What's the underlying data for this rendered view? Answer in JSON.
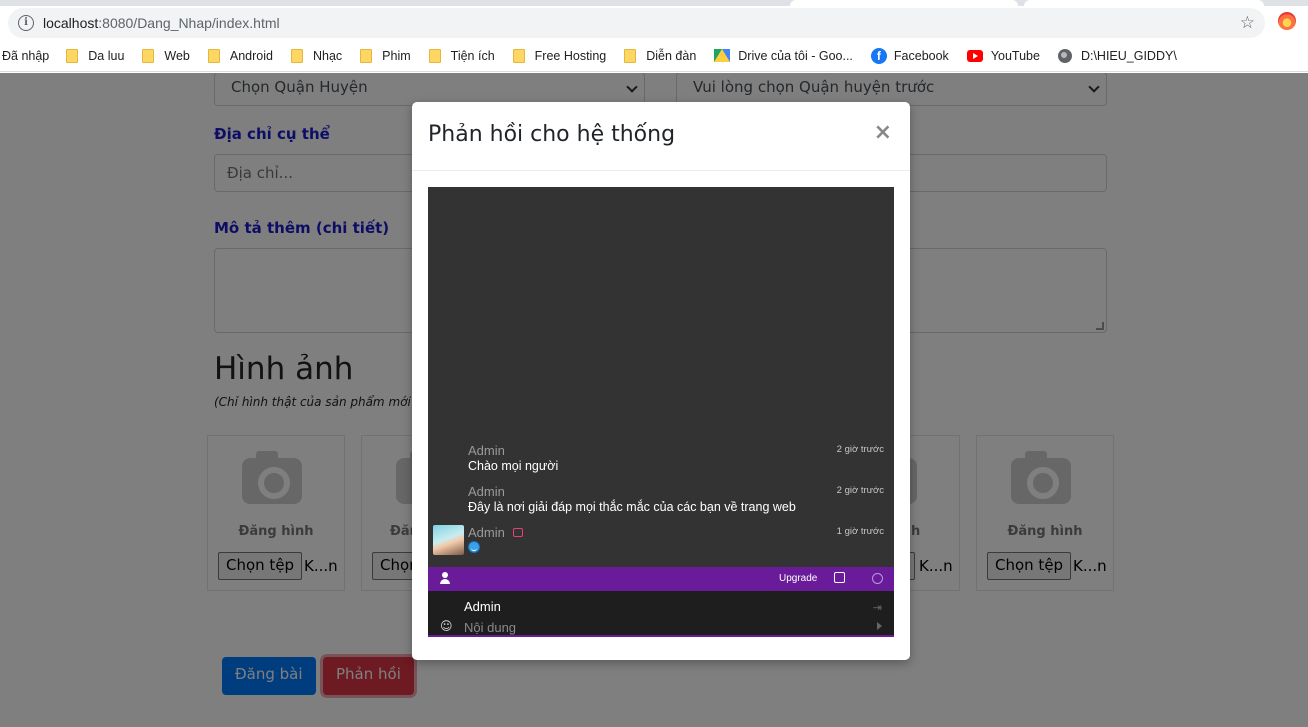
{
  "browser": {
    "url_host": "localhost",
    "url_path": ":8080/Dang_Nhap/index.html",
    "bookmarks": [
      {
        "label": "Đã nhập",
        "icon": "none"
      },
      {
        "label": "Da luu",
        "icon": "folder-icon"
      },
      {
        "label": "Web",
        "icon": "folder-icon"
      },
      {
        "label": "Android",
        "icon": "folder-icon"
      },
      {
        "label": "Nhạc",
        "icon": "folder-icon"
      },
      {
        "label": "Phim",
        "icon": "folder-icon"
      },
      {
        "label": "Tiện ích",
        "icon": "folder-icon"
      },
      {
        "label": "Free Hosting",
        "icon": "folder-icon"
      },
      {
        "label": "Diễn đàn",
        "icon": "folder-icon"
      },
      {
        "label": "Drive của tôi - Goo...",
        "icon": "drive-icon"
      },
      {
        "label": "Facebook",
        "icon": "facebook-icon"
      },
      {
        "label": "YouTube",
        "icon": "youtube-icon"
      },
      {
        "label": "D:\\HIEU_GIDDY\\",
        "icon": "globe-icon"
      }
    ]
  },
  "form": {
    "district_select": "Chọn Quận Huyện",
    "ward_select": "Vui lòng chọn Quận huyện trước",
    "address_label": "Địa chỉ cụ thể",
    "address_placeholder": "Địa chỉ...",
    "description_label": "Mô tả thêm (chi tiết)",
    "images_heading": "Hình ảnh",
    "images_note": "(Chỉ hình thật của sản phẩm mới đư",
    "image_card_caption": "Đăng hình",
    "image_card_caption_partial": "Đăr",
    "image_card_caption_tail": "h",
    "choose_file": "Chọn tệp",
    "choose_file_partial": "Chọn",
    "no_file": "K...n",
    "submit_button": "Đăng bài",
    "feedback_button": "Phản hồi"
  },
  "modal": {
    "title": "Phản hồi cho hệ thống",
    "close": "×",
    "chat": {
      "messages": [
        {
          "author": "Admin",
          "text": "Chào mọi người",
          "time": "2 giờ trước"
        },
        {
          "author": "Admin",
          "text": "Đây là nơi giải đáp mọi thắc mắc của các bạn về trang web",
          "time": "2 giờ trước"
        },
        {
          "author": "Admin",
          "text": "",
          "time": "1 giờ trước"
        }
      ],
      "upgrade_label": "Upgrade",
      "current_user": "Admin",
      "input_placeholder": "Nội dung",
      "accent_color": "#6a1b9a"
    }
  }
}
